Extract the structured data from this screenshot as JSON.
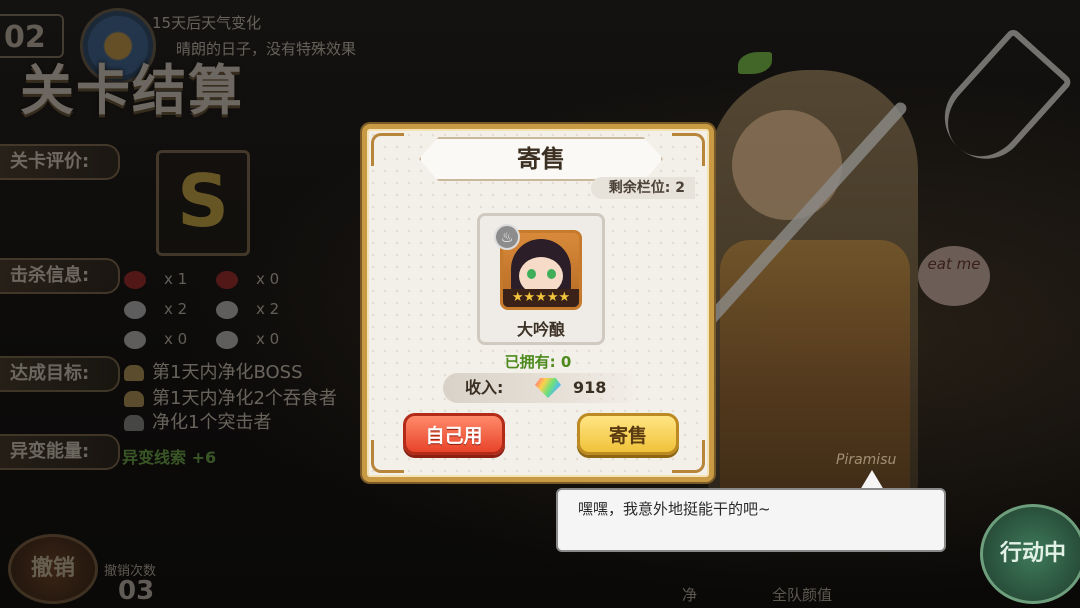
{
  "hud": {
    "day": "02",
    "weather_title": "15天后天气变化",
    "weather_desc": "晴朗的日子，没有特殊效果"
  },
  "settlement": {
    "title": "关卡结算",
    "rating_label": "关卡评价:",
    "rating": "S",
    "kills_label": "击杀信息:",
    "kills": [
      "x 1",
      "x 0",
      "x 2",
      "x 2",
      "x 0",
      "x 0"
    ],
    "goals_label": "达成目标:",
    "goals": [
      "第1天内净化BOSS",
      "第1天内净化2个吞食者",
      "净化1个突击者"
    ],
    "energy_label": "异变能量:",
    "energy_value": "异变线索 +6"
  },
  "bottom": {
    "undo_label": "撤销",
    "undo_count_label": "撤销次数",
    "undo_count": "03",
    "tab_left": "净",
    "tab_right": "全队颜值",
    "action_label": "行动中"
  },
  "character": {
    "badge_text": "eat me",
    "signature": "Piramisu"
  },
  "dialog": {
    "title": "寄售",
    "slots_label": "剩余栏位: 2",
    "item_name": "大吟酿",
    "item_stars": "★★★★★",
    "owned_label": "已拥有:  0",
    "income_label": "收入:",
    "income_value": "918",
    "btn_self": "自己用",
    "btn_sell": "寄售"
  },
  "speech": {
    "text": "嘿嘿，我意外地挺能干的吧~"
  },
  "colors": {
    "frame_gold": "#c89a44",
    "btn_red": "#e8442a",
    "btn_yellow": "#f0c23a",
    "owned_green": "#4c8a1e"
  }
}
